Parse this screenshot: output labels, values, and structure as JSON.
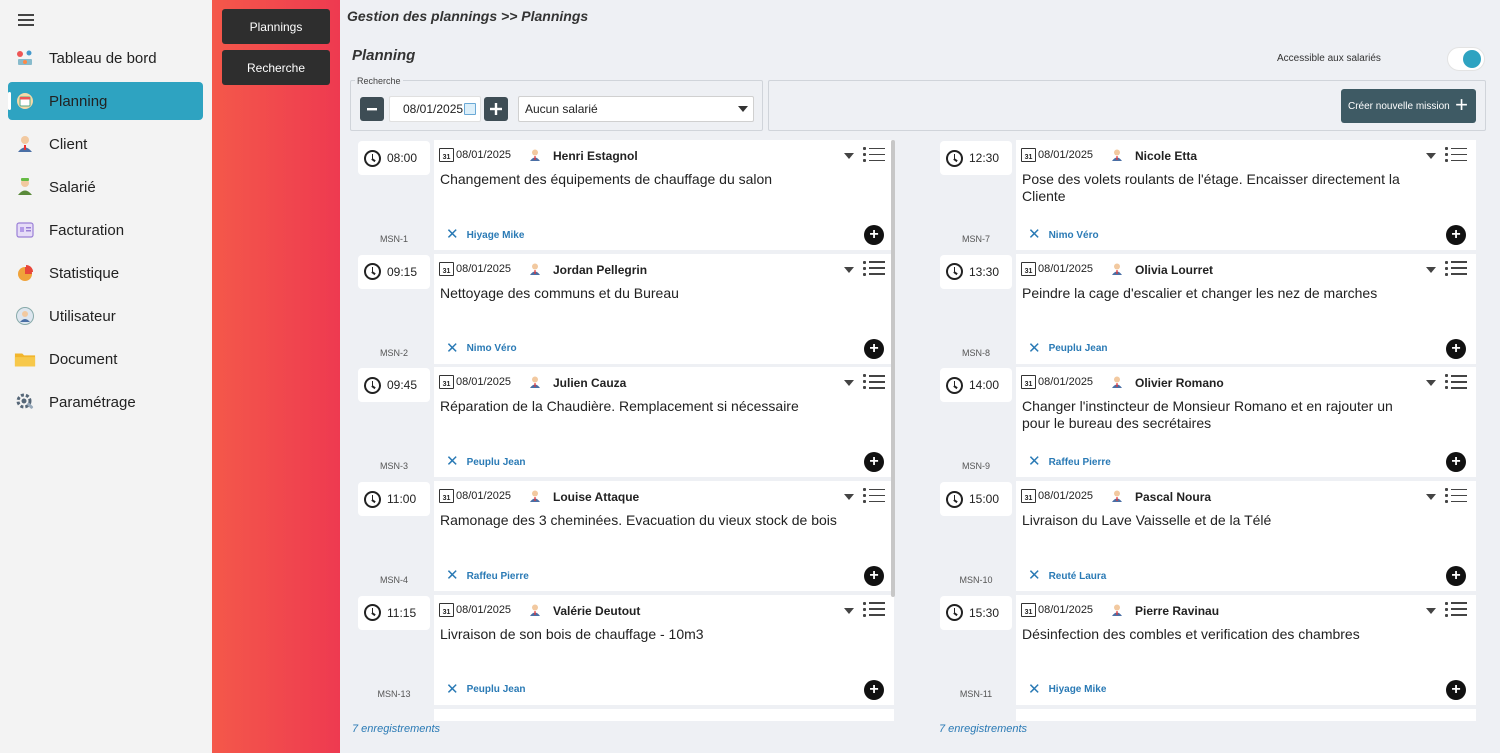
{
  "sidebar": {
    "items": [
      {
        "label": "Tableau de bord",
        "icon": "dashboard-icon"
      },
      {
        "label": "Planning",
        "icon": "planning-icon",
        "active": true
      },
      {
        "label": "Client",
        "icon": "client-icon"
      },
      {
        "label": "Salarié",
        "icon": "employee-icon"
      },
      {
        "label": "Facturation",
        "icon": "invoice-icon"
      },
      {
        "label": "Statistique",
        "icon": "pie-chart-icon"
      },
      {
        "label": "Utilisateur",
        "icon": "user-icon"
      },
      {
        "label": "Document",
        "icon": "folder-icon"
      },
      {
        "label": "Paramétrage",
        "icon": "settings-icon"
      }
    ]
  },
  "submenu": {
    "plannings": "Plannings",
    "recherche": "Recherche"
  },
  "header": {
    "breadcrumb": "Gestion des plannings >> Plannings",
    "title": "Planning",
    "toggle_label": "Accessible aux salariés"
  },
  "search": {
    "legend": "Recherche",
    "date": "08/01/2025",
    "employee": "Aucun salarié",
    "create_label": "Créer nouvelle mission"
  },
  "colors": {
    "accent": "#2ea3c1",
    "dark_button": "#3e4d55",
    "link": "#2a7ab5"
  },
  "left_column": {
    "records": "7 enregistrements",
    "cards": [
      {
        "time": "08:00",
        "date": "08/01/2025",
        "client": "Henri Estagnol",
        "desc": "Changement des équipements de chauffage du salon",
        "assignee": "Hiyage Mike",
        "msn": "MSN-1"
      },
      {
        "time": "09:15",
        "date": "08/01/2025",
        "client": "Jordan Pellegrin",
        "desc": "Nettoyage des communs et du Bureau",
        "assignee": "Nimo Véro",
        "msn": "MSN-2"
      },
      {
        "time": "09:45",
        "date": "08/01/2025",
        "client": "Julien Cauza",
        "desc": "Réparation de la Chaudière. Remplacement si nécessaire",
        "assignee": "Peuplu Jean",
        "msn": "MSN-3"
      },
      {
        "time": "11:00",
        "date": "08/01/2025",
        "client": "Louise Attaque",
        "desc": "Ramonage des 3 cheminées. Evacuation du vieux stock de bois",
        "assignee": "Raffeu Pierre",
        "msn": "MSN-4"
      },
      {
        "time": "11:15",
        "date": "08/01/2025",
        "client": "Valérie Deutout",
        "desc": "Livraison de son bois de chauffage - 10m3",
        "assignee": "Peuplu Jean",
        "msn": "MSN-13"
      }
    ]
  },
  "right_column": {
    "records": "7 enregistrements",
    "cards": [
      {
        "time": "12:30",
        "date": "08/01/2025",
        "client": "Nicole Etta",
        "desc": "Pose des volets roulants de l'étage. Encaisser directement la Cliente",
        "assignee": "Nimo Véro",
        "msn": "MSN-7"
      },
      {
        "time": "13:30",
        "date": "08/01/2025",
        "client": "Olivia Lourret",
        "desc": "Peindre la cage d'escalier et changer les nez de marches",
        "assignee": "Peuplu Jean",
        "msn": "MSN-8"
      },
      {
        "time": "14:00",
        "date": "08/01/2025",
        "client": "Olivier Romano",
        "desc": "Changer l'instincteur de Monsieur Romano et en rajouter un pour le bureau des secrétaires",
        "assignee": "Raffeu Pierre",
        "msn": "MSN-9"
      },
      {
        "time": "15:00",
        "date": "08/01/2025",
        "client": "Pascal Noura",
        "desc": "Livraison du Lave Vaisselle et de la Télé",
        "assignee": "Reuté Laura",
        "msn": "MSN-10"
      },
      {
        "time": "15:30",
        "date": "08/01/2025",
        "client": "Pierre Ravinau",
        "desc": "Désinfection des combles et verification des chambres",
        "assignee": "Hiyage Mike",
        "msn": "MSN-11"
      }
    ]
  }
}
